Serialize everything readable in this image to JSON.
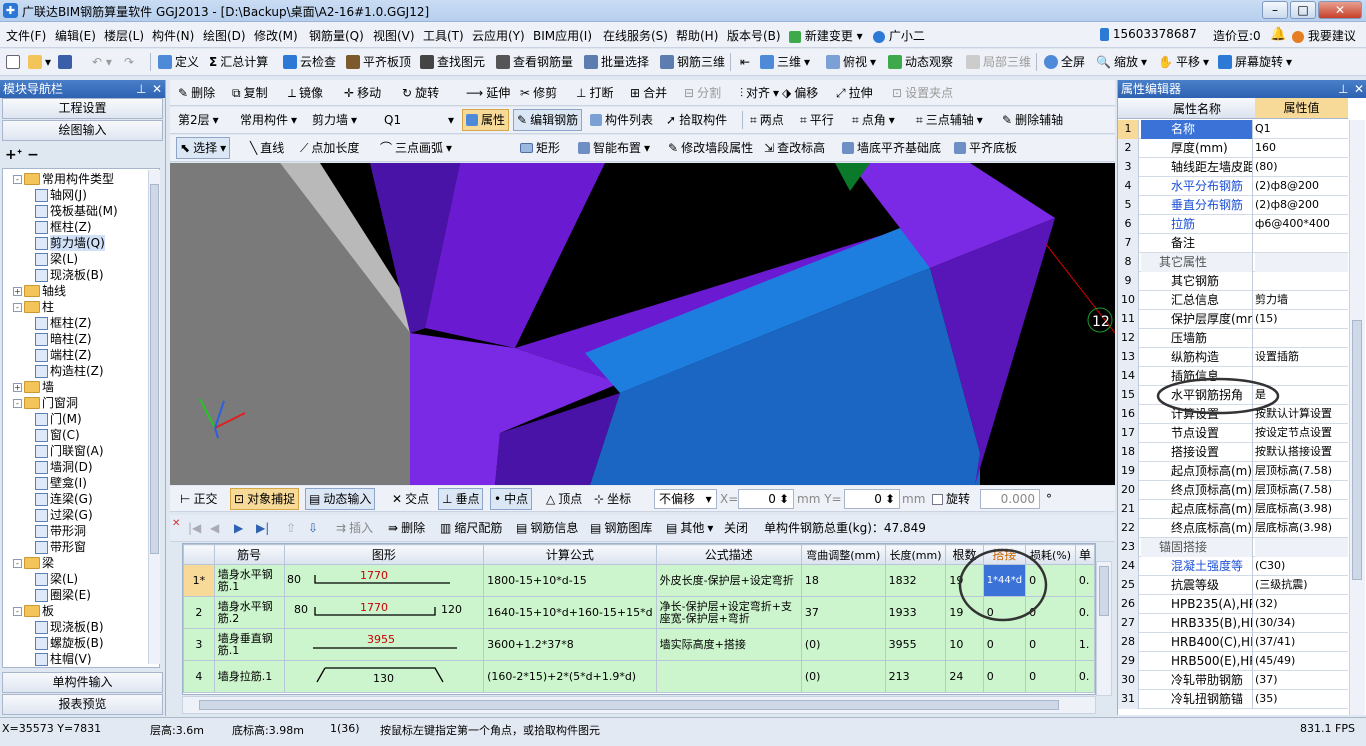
{
  "title": "广联达BIM钢筋算量软件 GGJ2013 - [D:\\Backup\\桌面\\A2-16#1.0.GGJ12]",
  "menu": [
    "文件(F)",
    "编辑(E)",
    "楼层(L)",
    "构件(N)",
    "绘图(D)",
    "修改(M)",
    "钢筋量(Q)",
    "视图(V)",
    "工具(T)",
    "云应用(Y)",
    "BIM应用(I)",
    "在线服务(S)",
    "帮助(H)",
    "版本号(B)",
    "新建变更",
    "广小二"
  ],
  "menu_right": {
    "phone": "15603378687",
    "cost": "造价豆:0",
    "want_suggest": "我要建议"
  },
  "toolbar1": [
    "定义",
    "汇总计算",
    "云检查",
    "平齐板顶",
    "查找图元",
    "查看钢筋量",
    "批量选择",
    "钢筋三维",
    "三维",
    "俯视",
    "动态观察",
    "局部三维",
    "全屏",
    "缩放",
    "平移",
    "屏幕旋转"
  ],
  "toolbar2": [
    "删除",
    "复制",
    "镜像",
    "移动",
    "旋转",
    "延伸",
    "修剪",
    "打断",
    "合并",
    "分割",
    "对齐",
    "偏移",
    "拉伸",
    "设置夹点"
  ],
  "toolbar3": {
    "floor": "第2层",
    "category": "常用构件",
    "type": "剪力墙",
    "element": "Q1",
    "items": [
      "属性",
      "编辑钢筋",
      "构件列表",
      "拾取构件",
      "两点",
      "平行",
      "点角",
      "三点辅轴",
      "删除辅轴"
    ]
  },
  "toolbar4": [
    "选择",
    "直线",
    "点加长度",
    "三点画弧",
    "矩形",
    "智能布置",
    "修改墙段属性",
    "查改标高",
    "墙底平齐基础底",
    "平齐底板"
  ],
  "nav": {
    "title": "模块导航栏",
    "btn_project": "工程设置",
    "btn_draw": "绘图输入",
    "btn_single": "单构件输入",
    "btn_report": "报表预览",
    "tree": [
      {
        "label": "常用构件类型",
        "level": 0,
        "kind": "folder",
        "exp": "-"
      },
      {
        "label": "轴网(J)",
        "level": 1,
        "kind": "leaf"
      },
      {
        "label": "筏板基础(M)",
        "level": 1,
        "kind": "leaf"
      },
      {
        "label": "框柱(Z)",
        "level": 1,
        "kind": "leaf"
      },
      {
        "label": "剪力墙(Q)",
        "level": 1,
        "kind": "leaf"
      },
      {
        "label": "梁(L)",
        "level": 1,
        "kind": "leaf"
      },
      {
        "label": "现浇板(B)",
        "level": 1,
        "kind": "leaf"
      },
      {
        "label": "轴线",
        "level": 0,
        "kind": "folder",
        "exp": "+"
      },
      {
        "label": "柱",
        "level": 0,
        "kind": "folder",
        "exp": "-"
      },
      {
        "label": "框柱(Z)",
        "level": 1,
        "kind": "leaf"
      },
      {
        "label": "暗柱(Z)",
        "level": 1,
        "kind": "leaf"
      },
      {
        "label": "端柱(Z)",
        "level": 1,
        "kind": "leaf"
      },
      {
        "label": "构造柱(Z)",
        "level": 1,
        "kind": "leaf"
      },
      {
        "label": "墙",
        "level": 0,
        "kind": "folder",
        "exp": "+"
      },
      {
        "label": "门窗洞",
        "level": 0,
        "kind": "folder",
        "exp": "-"
      },
      {
        "label": "门(M)",
        "level": 1,
        "kind": "leaf"
      },
      {
        "label": "窗(C)",
        "level": 1,
        "kind": "leaf"
      },
      {
        "label": "门联窗(A)",
        "level": 1,
        "kind": "leaf"
      },
      {
        "label": "墙洞(D)",
        "level": 1,
        "kind": "leaf"
      },
      {
        "label": "壁龛(I)",
        "level": 1,
        "kind": "leaf"
      },
      {
        "label": "连梁(G)",
        "level": 1,
        "kind": "leaf"
      },
      {
        "label": "过梁(G)",
        "level": 1,
        "kind": "leaf"
      },
      {
        "label": "带形洞",
        "level": 1,
        "kind": "leaf"
      },
      {
        "label": "带形窗",
        "level": 1,
        "kind": "leaf"
      },
      {
        "label": "梁",
        "level": 0,
        "kind": "folder",
        "exp": "-"
      },
      {
        "label": "梁(L)",
        "level": 1,
        "kind": "leaf"
      },
      {
        "label": "圈梁(E)",
        "level": 1,
        "kind": "leaf"
      },
      {
        "label": "板",
        "level": 0,
        "kind": "folder",
        "exp": "-"
      },
      {
        "label": "现浇板(B)",
        "level": 1,
        "kind": "leaf"
      },
      {
        "label": "螺旋板(B)",
        "level": 1,
        "kind": "leaf"
      },
      {
        "label": "柱帽(V)",
        "level": 1,
        "kind": "leaf"
      }
    ]
  },
  "viewport": {
    "axis_label": "12"
  },
  "snapbar": {
    "ortho": "正交",
    "snap": "对象捕捉",
    "dyn": "动态输入",
    "cross": "交点",
    "perp": "垂点",
    "mid": "中点",
    "vertex": "顶点",
    "coord": "坐标",
    "offset": "不偏移",
    "x_label": "X=",
    "x_val": "0",
    "y_label": "mm Y=",
    "y_val": "0",
    "mm": "mm",
    "rotate": "旋转",
    "rot_val": "0.000",
    "deg": "°"
  },
  "rebar_toolbar": {
    "insert": "插入",
    "delete": "删除",
    "scale": "缩尺配筋",
    "info": "钢筋信息",
    "lib": "钢筋图库",
    "other": "其他",
    "close": "关闭",
    "total": "单构件钢筋总重(kg)：47.849"
  },
  "rebar_table": {
    "headers": [
      "筋号",
      "图形",
      "计算公式",
      "公式描述",
      "弯曲调整(mm)",
      "长度(mm)",
      "根数",
      "搭接",
      "损耗(%)",
      "单"
    ],
    "rows": [
      {
        "no": "1*",
        "name": "墙身水平钢筋.1",
        "shape_l": "80",
        "shape_m": "1770",
        "shape_r": "",
        "formula": "1800-15+10*d-15",
        "desc": "外皮长度-保护层+设定弯折",
        "bend": "18",
        "length": "1832",
        "count": "19",
        "lap": "1*44*d",
        "loss": "0",
        "unit": "0."
      },
      {
        "no": "2",
        "name": "墙身水平钢筋.2",
        "shape_l": "80",
        "shape_m": "1770",
        "shape_r": "120",
        "formula": "1640-15+10*d+160-15+15*d",
        "desc": "净长-保护层+设定弯折+支座宽-保护层+弯折",
        "bend": "37",
        "length": "1933",
        "count": "19",
        "lap": "0",
        "loss": "0",
        "unit": "0."
      },
      {
        "no": "3",
        "name": "墙身垂直钢筋.1",
        "shape_l": "",
        "shape_m": "3955",
        "shape_r": "",
        "formula": "3600+1.2*37*8",
        "desc": "墙实际高度+搭接",
        "bend": "(0)",
        "length": "3955",
        "count": "10",
        "lap": "0",
        "loss": "0",
        "unit": "1."
      },
      {
        "no": "4",
        "name": "墙身拉筋.1",
        "shape_l": "",
        "shape_m": "130",
        "shape_r": "",
        "formula": "(160-2*15)+2*(5*d+1.9*d)",
        "desc": "",
        "bend": "(0)",
        "length": "213",
        "count": "24",
        "lap": "0",
        "loss": "0",
        "unit": "0."
      }
    ]
  },
  "props": {
    "title": "属性编辑器",
    "col_name": "属性名称",
    "col_value": "属性值",
    "rows": [
      {
        "n": "1",
        "k": "名称",
        "v": "Q1",
        "blue": true
      },
      {
        "n": "2",
        "k": "厚度(mm)",
        "v": "160"
      },
      {
        "n": "3",
        "k": "轴线距左墙皮距",
        "v": "(80)"
      },
      {
        "n": "4",
        "k": "水平分布钢筋",
        "v": "(2)ф8@200",
        "blue": true
      },
      {
        "n": "5",
        "k": "垂直分布钢筋",
        "v": "(2)ф8@200",
        "blue": true
      },
      {
        "n": "6",
        "k": "拉筋",
        "v": "ф6@400*400",
        "blue": true
      },
      {
        "n": "7",
        "k": "备注",
        "v": ""
      },
      {
        "n": "8",
        "k": "其它属性",
        "v": "",
        "group": true
      },
      {
        "n": "9",
        "k": "其它钢筋",
        "v": ""
      },
      {
        "n": "10",
        "k": "汇总信息",
        "v": "剪力墙"
      },
      {
        "n": "11",
        "k": "保护层厚度(mm",
        "v": "(15)"
      },
      {
        "n": "12",
        "k": "压墙筋",
        "v": ""
      },
      {
        "n": "13",
        "k": "纵筋构造",
        "v": "设置插筋"
      },
      {
        "n": "14",
        "k": "插筋信息",
        "v": ""
      },
      {
        "n": "15",
        "k": "水平钢筋拐角",
        "v": "是"
      },
      {
        "n": "16",
        "k": "计算设置",
        "v": "按默认计算设置"
      },
      {
        "n": "17",
        "k": "节点设置",
        "v": "按设定节点设置"
      },
      {
        "n": "18",
        "k": "搭接设置",
        "v": "按默认搭接设置"
      },
      {
        "n": "19",
        "k": "起点顶标高(m)",
        "v": "层顶标高(7.58)"
      },
      {
        "n": "20",
        "k": "终点顶标高(m)",
        "v": "层顶标高(7.58)"
      },
      {
        "n": "21",
        "k": "起点底标高(m)",
        "v": "层底标高(3.98)"
      },
      {
        "n": "22",
        "k": "终点底标高(m)",
        "v": "层底标高(3.98)"
      },
      {
        "n": "23",
        "k": "锚固搭接",
        "v": "",
        "group": true
      },
      {
        "n": "24",
        "k": "混凝土强度等",
        "v": "(C30)",
        "blue": true
      },
      {
        "n": "25",
        "k": "抗震等级",
        "v": "(三级抗震)"
      },
      {
        "n": "26",
        "k": "HPB235(A),HPB",
        "v": "(32)"
      },
      {
        "n": "27",
        "k": "HRB335(B),HRB",
        "v": "(30/34)"
      },
      {
        "n": "28",
        "k": "HRB400(C),HRB",
        "v": "(37/41)"
      },
      {
        "n": "29",
        "k": "HRB500(E),HRB",
        "v": "(45/49)"
      },
      {
        "n": "30",
        "k": "冷轧带肋钢筋",
        "v": "(37)"
      },
      {
        "n": "31",
        "k": "冷轧扭钢筋锚",
        "v": "(35)"
      }
    ]
  },
  "status": {
    "xy": "X=35573 Y=7831",
    "floor_h": "层高:3.6m",
    "bottom": "底标高:3.98m",
    "count": "1(36)",
    "hint": "按鼠标左键指定第一个角点，或拾取构件图元",
    "fps": "831.1 FPS"
  },
  "colors": {
    "accent": "#2d62b2",
    "wall_purple": "#6a1bd1",
    "wall_blue": "#1d7ee0",
    "row_green": "#cdf5cd"
  }
}
